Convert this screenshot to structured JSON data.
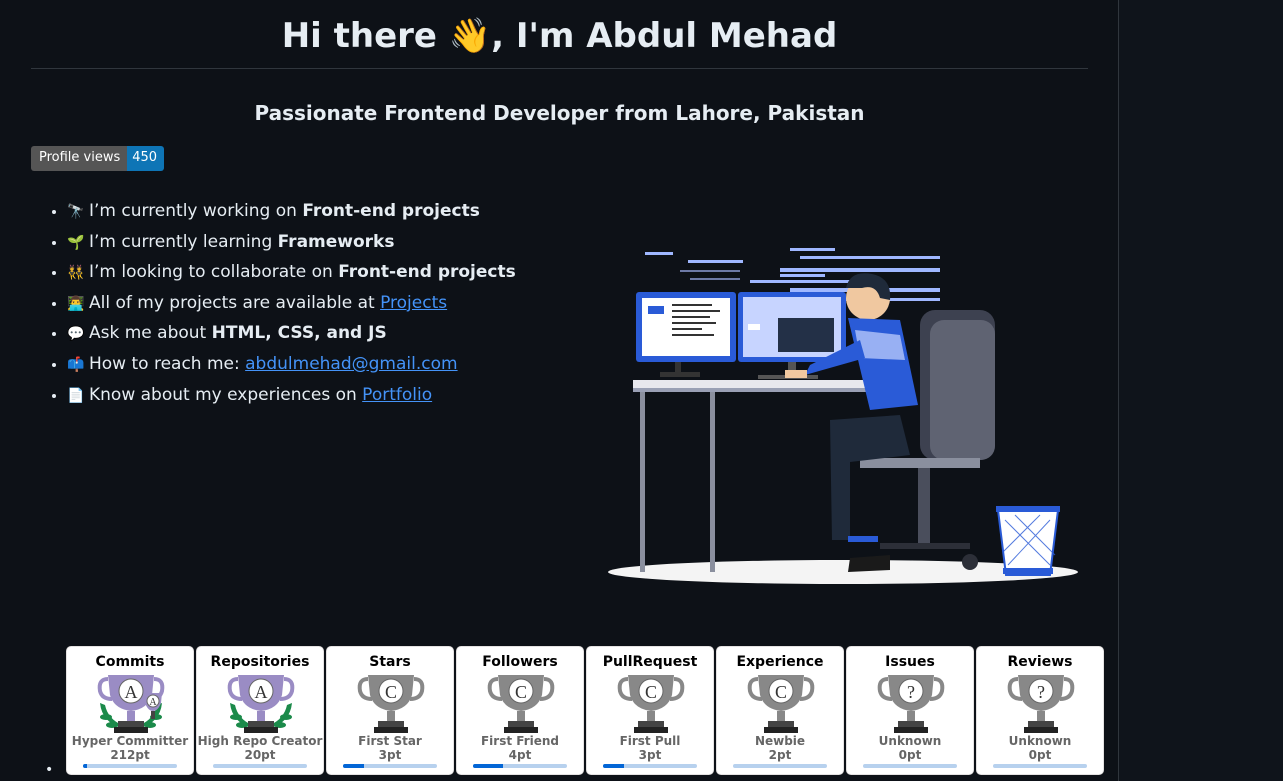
{
  "header": {
    "title": "Hi there 👋, I'm Abdul Mehad",
    "subtitle": "Passionate Frontend Developer from Lahore, Pakistan"
  },
  "badge": {
    "label": "Profile views",
    "value": "450"
  },
  "bio": [
    {
      "emoji": "🔭",
      "prefix": "I’m currently working on ",
      "bold": "Front-end projects"
    },
    {
      "emoji": "🌱",
      "prefix": "I’m currently learning ",
      "bold": "Frameworks"
    },
    {
      "emoji": "👯",
      "prefix": "I’m looking to collaborate on ",
      "bold": "Front-end projects"
    },
    {
      "emoji": "👨‍💻",
      "prefix": "All of my projects are available at ",
      "link": "Projects"
    },
    {
      "emoji": "💬",
      "prefix": "Ask me about ",
      "bold": "HTML, CSS, and JS"
    },
    {
      "emoji": "📫",
      "prefix": "How to reach me: ",
      "link": "abdulmehad@gmail.com"
    },
    {
      "emoji": "📄",
      "prefix": "Know about my experiences on ",
      "link": "Portfolio"
    }
  ],
  "trophies": [
    {
      "name": "Commits",
      "grade": "A",
      "rank": "Hyper Committer",
      "points": "212pt",
      "progress": 0.04,
      "color": "#9a8cc4",
      "laurel": true,
      "mini": "A"
    },
    {
      "name": "Repositories",
      "grade": "A",
      "rank": "High Repo Creator",
      "points": "20pt",
      "progress": 0.0,
      "color": "#9a8cc4",
      "laurel": true,
      "mini": ""
    },
    {
      "name": "Stars",
      "grade": "C",
      "rank": "First Star",
      "points": "3pt",
      "progress": 0.22,
      "color": "#888888",
      "laurel": false,
      "mini": ""
    },
    {
      "name": "Followers",
      "grade": "C",
      "rank": "First Friend",
      "points": "4pt",
      "progress": 0.32,
      "color": "#888888",
      "laurel": false,
      "mini": ""
    },
    {
      "name": "PullRequest",
      "grade": "C",
      "rank": "First Pull",
      "points": "3pt",
      "progress": 0.22,
      "color": "#888888",
      "laurel": false,
      "mini": ""
    },
    {
      "name": "Experience",
      "grade": "C",
      "rank": "Newbie",
      "points": "2pt",
      "progress": 0.0,
      "color": "#888888",
      "laurel": false,
      "mini": ""
    },
    {
      "name": "Issues",
      "grade": "?",
      "rank": "Unknown",
      "points": "0pt",
      "progress": 0.0,
      "color": "#888888",
      "laurel": false,
      "mini": ""
    },
    {
      "name": "Reviews",
      "grade": "?",
      "rank": "Unknown",
      "points": "0pt",
      "progress": 0.0,
      "color": "#888888",
      "laurel": false,
      "mini": ""
    }
  ]
}
